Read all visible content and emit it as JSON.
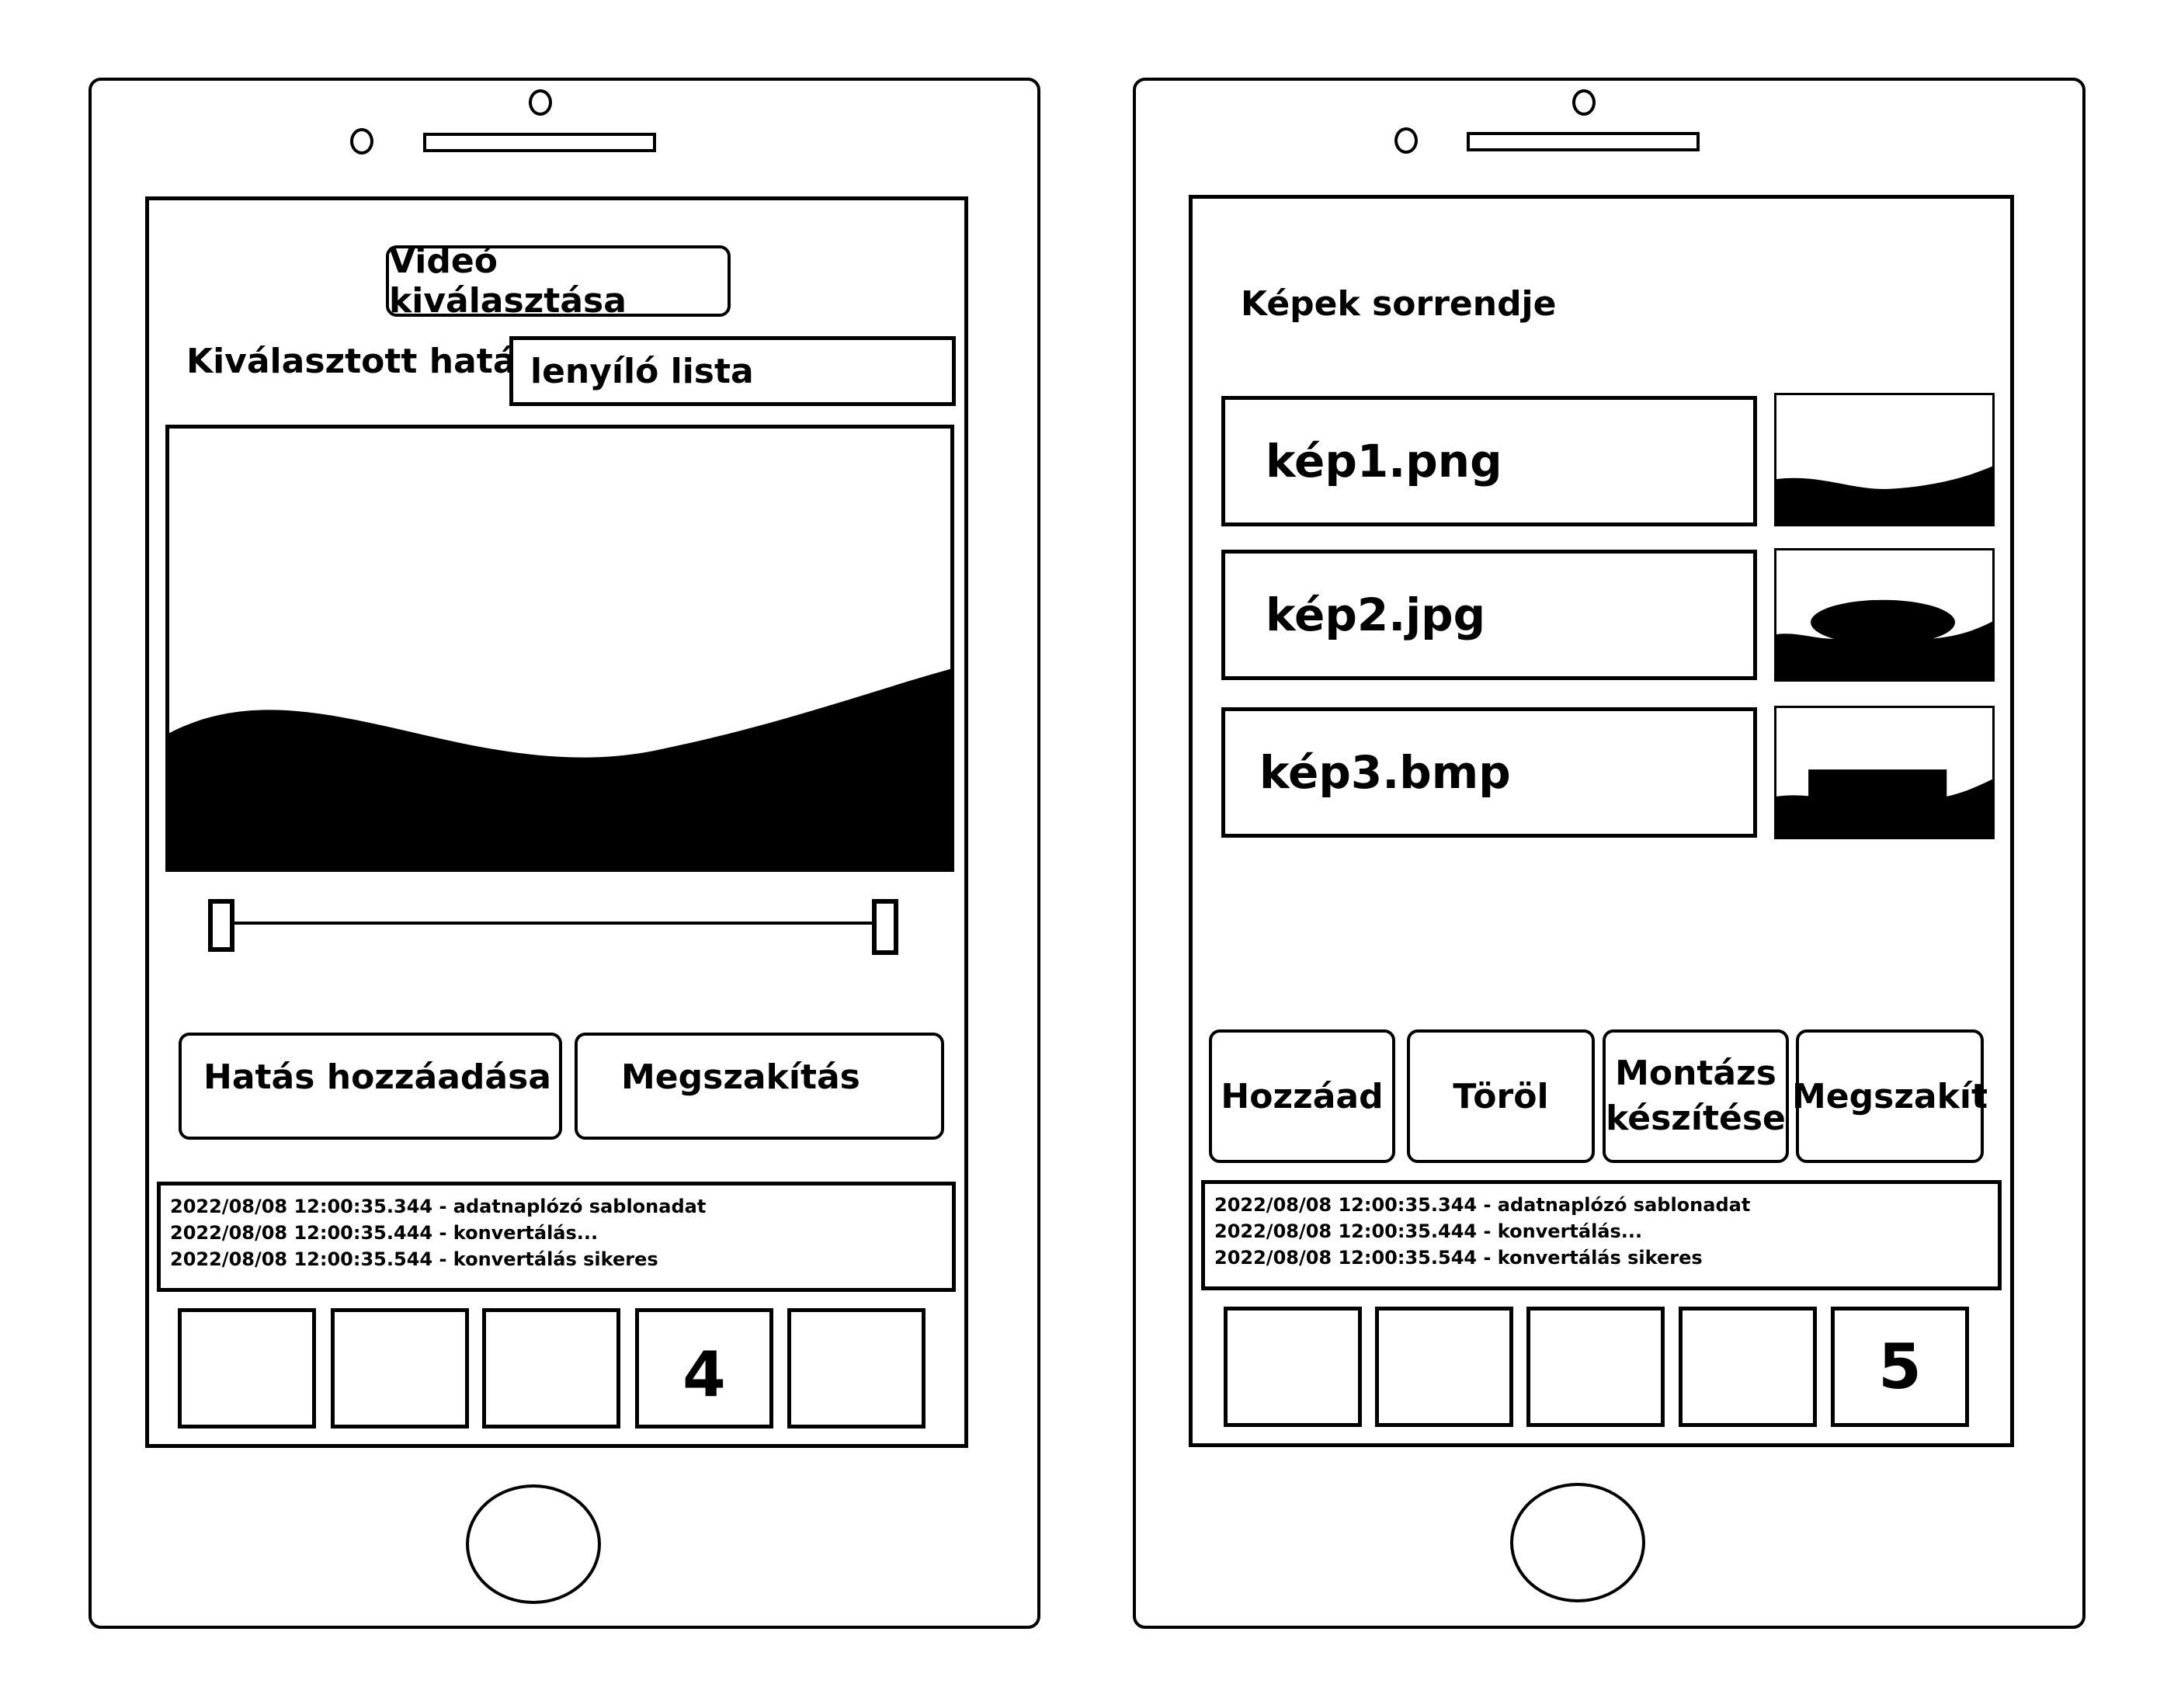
{
  "left": {
    "select_video_button": "Videó kiválasztása",
    "effect_label": "Kiválasztott hatás:",
    "effect_dropdown_value": "lenyíló lista",
    "add_effect_button": "Hatás hozzáadása",
    "cancel_button": "Megszakítás",
    "log_lines": [
      "2022/08/08 12:00:35.344 - adatnaplózó sablonadat",
      "2022/08/08 12:00:35.444 - konvertálás...",
      "2022/08/08 12:00:35.544 - konvertálás sikeres"
    ],
    "nav_labels": [
      "",
      "",
      "",
      "4",
      ""
    ]
  },
  "right": {
    "title": "Képek sorrendje",
    "files": [
      "kép1.png",
      "kép2.jpg",
      "kép3.bmp"
    ],
    "buttons": {
      "add": "Hozzáad",
      "delete": "Töröl",
      "montage_line1": "Montázs",
      "montage_line2": "készítése",
      "cancel": "Megszakít"
    },
    "log_lines": [
      "2022/08/08 12:00:35.344 - adatnaplózó sablonadat",
      "2022/08/08 12:00:35.444 - konvertálás...",
      "2022/08/08 12:00:35.544 - konvertálás sikeres"
    ],
    "nav_labels": [
      "",
      "",
      "",
      "",
      "5"
    ]
  }
}
